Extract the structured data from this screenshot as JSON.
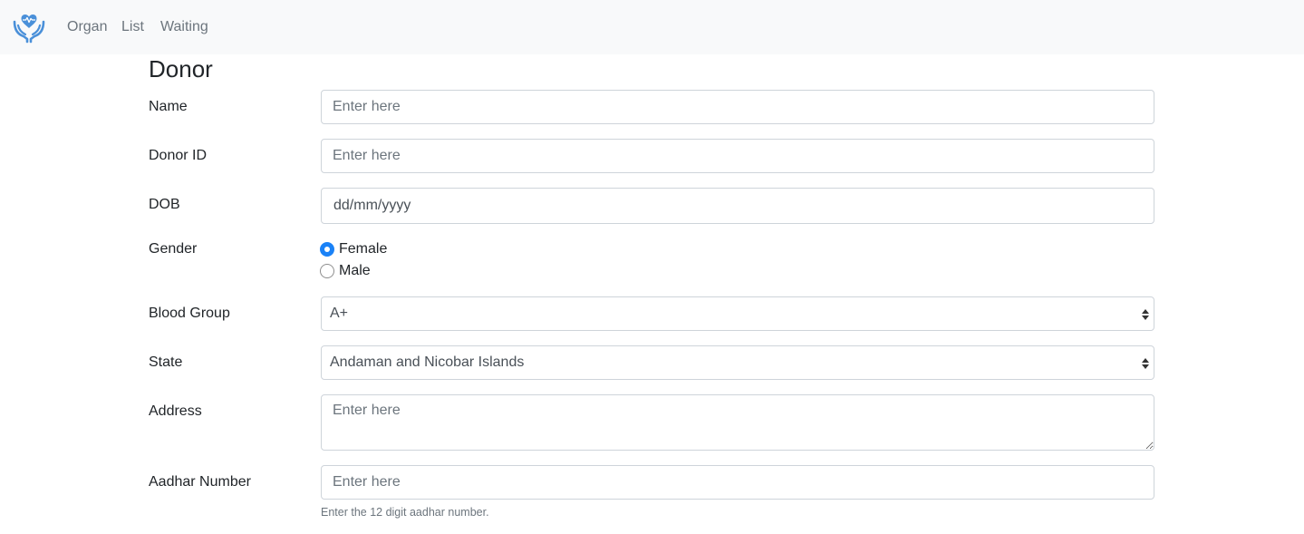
{
  "navbar": {
    "logo_icon": "hands-heart-icon",
    "links": [
      "Organ",
      "List",
      "Waiting"
    ]
  },
  "page": {
    "title": "Donor"
  },
  "form": {
    "name": {
      "label": "Name",
      "placeholder": "Enter here"
    },
    "donor_id": {
      "label": "Donor ID",
      "placeholder": "Enter here"
    },
    "dob": {
      "label": "DOB",
      "value": "dd/mm/yyyy"
    },
    "gender": {
      "label": "Gender",
      "options": [
        {
          "label": "Female",
          "checked": true
        },
        {
          "label": "Male",
          "checked": false
        }
      ]
    },
    "blood_group": {
      "label": "Blood Group",
      "selected": "A+"
    },
    "state": {
      "label": "State",
      "selected": "Andaman and Nicobar Islands"
    },
    "address": {
      "label": "Address",
      "placeholder": "Enter here"
    },
    "aadhar": {
      "label": "Aadhar Number",
      "placeholder": "Enter here",
      "help": "Enter the 12 digit aadhar number."
    }
  },
  "colors": {
    "accent": "#1a82f7",
    "logo": "#4a90d9",
    "navbar_bg": "#f8f9fa",
    "nav_link": "#6c757d",
    "border": "#ced4da"
  }
}
